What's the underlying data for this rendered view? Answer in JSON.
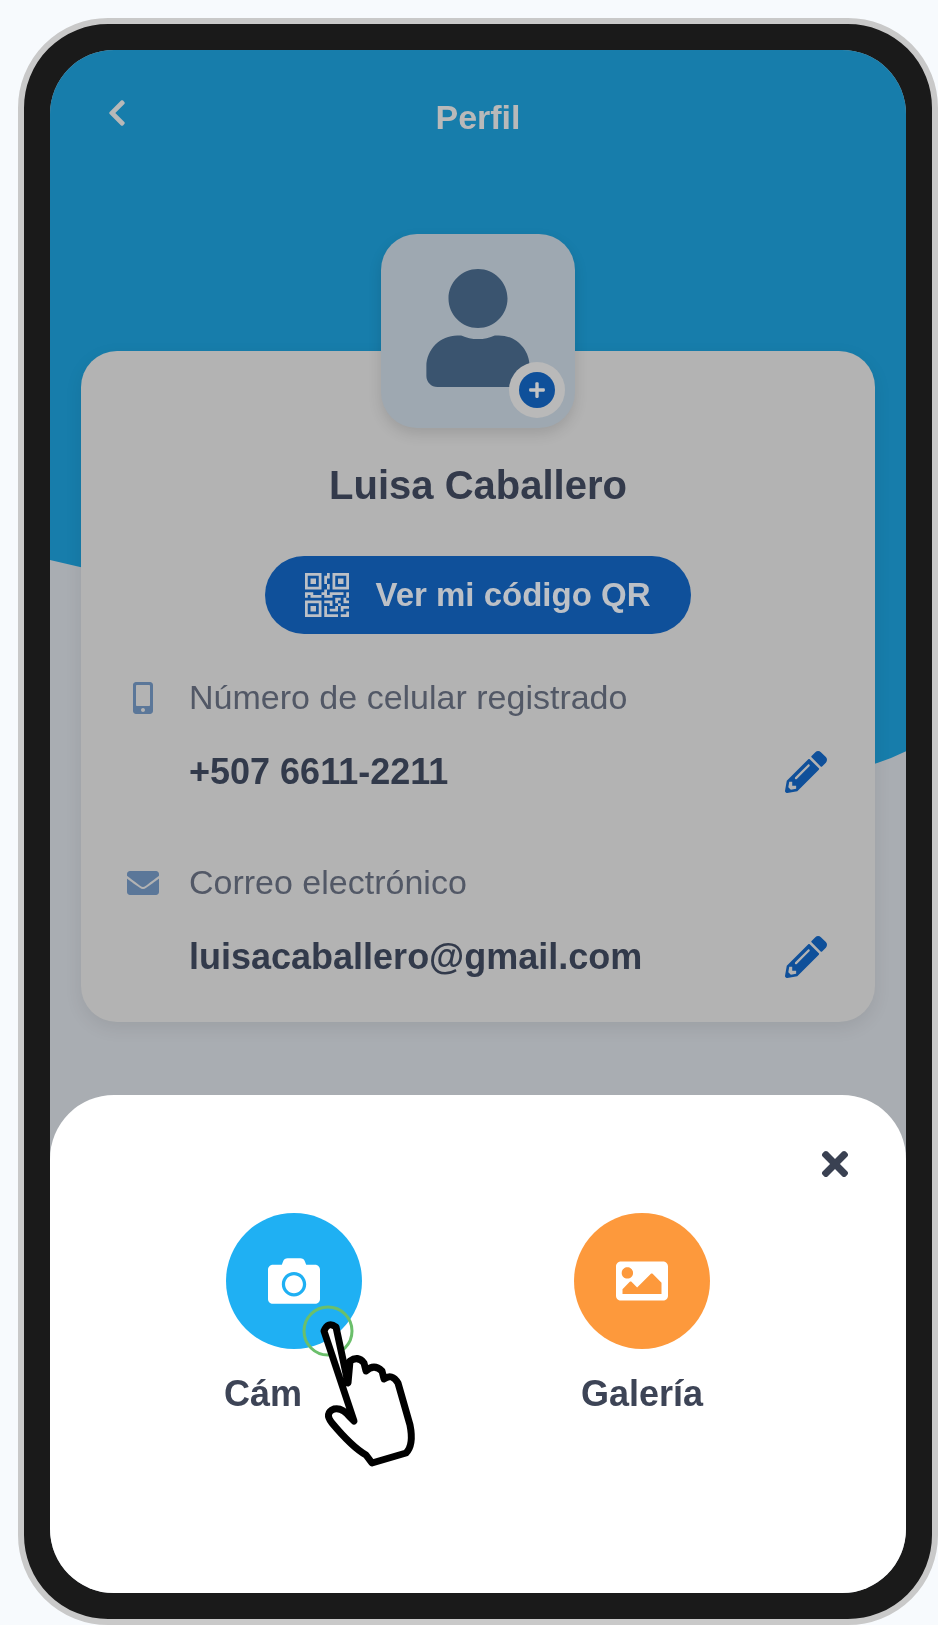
{
  "header": {
    "title": "Perfil"
  },
  "profile": {
    "name": "Luisa Caballero",
    "qr_button": "Ver mi código QR"
  },
  "fields": [
    {
      "kind": "phone",
      "label": "Número de celular registrado",
      "value": "+507 6611-2211"
    },
    {
      "kind": "email",
      "label": "Correo electrónico",
      "value": "luisacaballero@gmail.com"
    }
  ],
  "sheet": {
    "options": [
      {
        "kind": "camera",
        "label": "Cám",
        "color": "#1fb0f3",
        "pointed": true
      },
      {
        "kind": "gallery",
        "label": "Galería",
        "color": "#fd993c",
        "pointed": false
      }
    ]
  }
}
